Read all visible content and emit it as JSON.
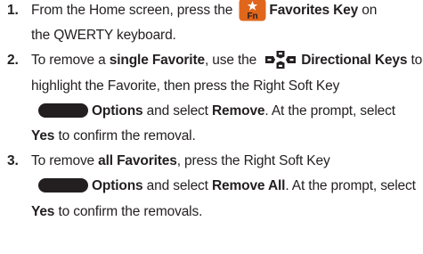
{
  "steps": [
    {
      "number": "1.",
      "lines": [
        {
          "t1": "From the Home screen, press the ",
          "key": "Favorites Key",
          "t2": " on"
        },
        {
          "t1": "the QWERTY keyboard."
        }
      ],
      "icon": {
        "name": "favorites-fn-key-icon",
        "label": "Fn",
        "symbol": "★",
        "color": "#e0661b"
      }
    },
    {
      "number": "2.",
      "lines": [
        {
          "t1": "To remove a ",
          "b1": "single Favorite",
          "t2": ", use the ",
          "b2": "Directional Keys",
          "t3": " to"
        },
        {
          "t1": "highlight the Favorite, then press the Right Soft Key"
        },
        {
          "b1": "Options",
          "t1": " and select ",
          "b2": "Remove",
          "t2": ". At the prompt, select"
        },
        {
          "b1": "Yes",
          "t1": " to confirm the removal."
        }
      ]
    },
    {
      "number": "3.",
      "lines": [
        {
          "t1": "To remove ",
          "b1": "all Favorites",
          "t2": ", press the Right Soft Key"
        },
        {
          "b1": "Options",
          "t1": " and select ",
          "b2": "Remove All",
          "t2": ". At the prompt, select"
        },
        {
          "b1": "Yes",
          "t1": " to confirm the removals."
        }
      ]
    }
  ]
}
